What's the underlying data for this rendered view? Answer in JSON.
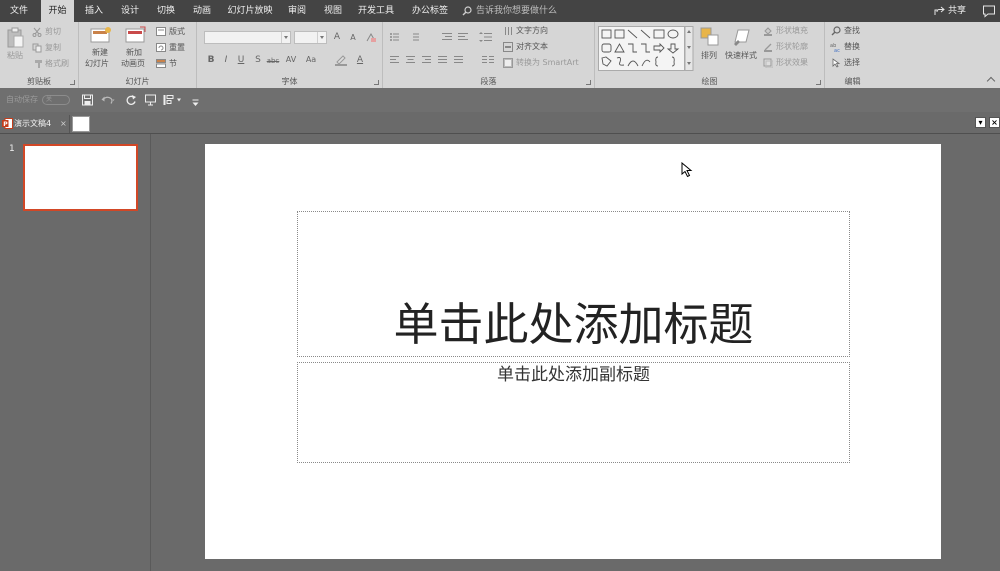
{
  "ribbon_tabs": [
    "文件",
    "开始",
    "插入",
    "设计",
    "切换",
    "动画",
    "幻灯片放映",
    "审阅",
    "视图",
    "开发工具",
    "办公标签"
  ],
  "active_tab": "开始",
  "search": {
    "placeholder": "告诉我你想要做什么"
  },
  "share_label": "共享",
  "clipboard": {
    "paste_label": "粘贴",
    "cut_label": "剪切",
    "copy_label": "复制",
    "format_painter_label": "格式刷",
    "group_label": "剪贴板"
  },
  "slides": {
    "new_slide_label_1": "新建",
    "new_slide_label_2": "幻灯片",
    "reuse_label_1": "新加",
    "reuse_label_2": "动画页",
    "layout_label": "版式",
    "reset_label": "重置",
    "section_label": "节",
    "group_label": "幻灯片"
  },
  "font": {
    "name_value": "",
    "size_value": "",
    "bold": "B",
    "italic": "I",
    "underline": "U",
    "shadow": "S",
    "strike": "abc",
    "spacing": "AV",
    "case": "Aa",
    "color": "A",
    "grow": "A",
    "shrink": "A",
    "group_label": "字体"
  },
  "paragraph": {
    "text_direction_label": "文字方向",
    "align_text_label": "对齐文本",
    "smartart_label": "转换为 SmartArt",
    "group_label": "段落"
  },
  "drawing": {
    "arrange_label": "排列",
    "quick_styles_label": "快速样式",
    "shape_fill_label": "形状填充",
    "shape_outline_label": "形状轮廓",
    "shape_effects_label": "形状效果",
    "group_label": "绘图"
  },
  "editing": {
    "find_label": "查找",
    "replace_label": "替换",
    "select_label": "选择",
    "group_label": "编辑"
  },
  "qat": {
    "autosave_label": "自动保存",
    "autosave_state": "关"
  },
  "document_tab": {
    "title": "演示文稿4",
    "close_glyph": "×"
  },
  "tab_controls": {
    "menu_glyph": "▾",
    "close_glyph": "×"
  },
  "thumbnails": [
    {
      "number": "1"
    }
  ],
  "slide": {
    "title_placeholder": "单击此处添加标题",
    "subtitle_placeholder": "单击此处添加副标题"
  },
  "colors": {
    "accent": "#d24726",
    "ribbon_bg": "#d6d6d6",
    "titlebar_bg": "#444444",
    "workspace_bg": "#6a6a6a"
  }
}
